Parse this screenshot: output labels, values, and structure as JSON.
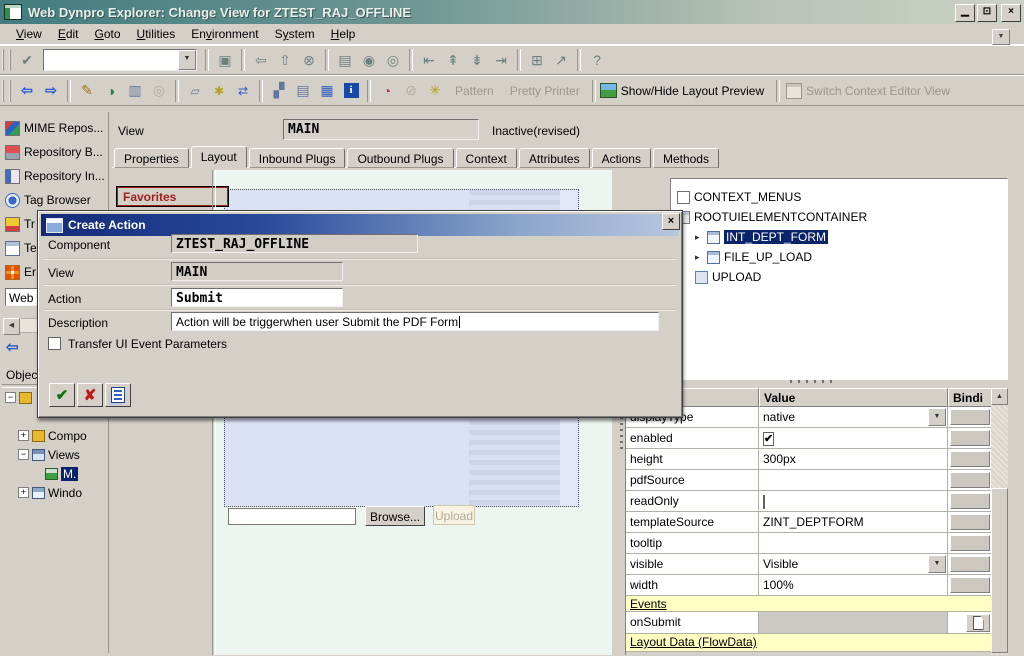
{
  "titlebar": {
    "title": "Web Dynpro Explorer: Change View for ZTEST_RAJ_OFFLINE"
  },
  "menubar": {
    "items": [
      {
        "label": "View",
        "u": 0
      },
      {
        "label": "Edit",
        "u": 0
      },
      {
        "label": "Goto",
        "u": 0
      },
      {
        "label": "Utilities",
        "u": 0
      },
      {
        "label": "Environment",
        "u": 2
      },
      {
        "label": "System",
        "u": 1
      },
      {
        "label": "Help",
        "u": 0
      }
    ]
  },
  "app_toolbar": {
    "pattern": "Pattern",
    "pretty_printer": "Pretty Printer",
    "show_hide_layout_preview": "Show/Hide Layout Preview",
    "switch_context_editor": "Switch Context Editor View"
  },
  "sidebar": {
    "buttons": [
      {
        "label": "MIME Repos...",
        "icon": "mime-repository-icon",
        "cls": "si-mime"
      },
      {
        "label": "Repository B...",
        "icon": "repository-browser-icon",
        "cls": "si-repob"
      },
      {
        "label": "Repository In...",
        "icon": "repository-infosystem-icon",
        "cls": "si-repoi"
      },
      {
        "label": "Tag Browser",
        "icon": "tag-browser-icon",
        "cls": "si-tag"
      },
      {
        "label": "Tr",
        "icon": "transport-icon",
        "cls": "si-truck"
      },
      {
        "label": "Te",
        "icon": "test-icon",
        "cls": "si-table"
      },
      {
        "label": "Er",
        "icon": "messages-icon",
        "cls": "si-grid"
      }
    ],
    "filter_value": "Web",
    "objects_label": "Objec",
    "tree": [
      {
        "label": "",
        "exp": "-",
        "icon": "ti-component",
        "level": 0
      },
      {
        "label": "",
        "spacer": true,
        "level": 1
      },
      {
        "label": "Compo",
        "exp": "+",
        "icon": "ti-component",
        "level": 1
      },
      {
        "label": "Views",
        "exp": "-",
        "icon": "ti-views",
        "level": 1
      },
      {
        "label": "M.",
        "icon": "ti-view",
        "level": 2,
        "selected": true
      },
      {
        "label": "Windo",
        "exp": "+",
        "icon": "ti-windows",
        "level": 1
      }
    ]
  },
  "view_header": {
    "label": "View",
    "value": "MAIN",
    "status": "Inactive(revised)"
  },
  "tabstrip": {
    "tabs": [
      "Properties",
      "Layout",
      "Inbound Plugs",
      "Outbound Plugs",
      "Context",
      "Attributes",
      "Actions",
      "Methods"
    ],
    "active": "Layout"
  },
  "layout_editor": {
    "favorites": "Favorites",
    "file_value": "",
    "browse": "Browse...",
    "upload": "Upload"
  },
  "dialog": {
    "title": "Create Action",
    "rows": [
      {
        "label": "Component",
        "value": "ZTEST_RAJ_OFFLINE",
        "readonly": true
      },
      {
        "label": "View",
        "value": "MAIN",
        "readonly": true
      },
      {
        "label": "Action",
        "value": "Submit",
        "readonly": false
      },
      {
        "label": "Description",
        "value": "Action will be triggerwhen user Submit the PDF Form",
        "readonly": false,
        "plain": true,
        "caret": true
      }
    ],
    "checkbox": {
      "label": "Transfer UI Event Parameters",
      "checked": false
    }
  },
  "ui_hierarchy": [
    {
      "label": "CONTEXT_MENUS",
      "icon": "ui-ctx",
      "icon_name": "context-menus-icon",
      "level": 0
    },
    {
      "label": "ROOTUIELEMENTCONTAINER",
      "icon": "ui-cont",
      "icon_name": "container-icon",
      "level": 0
    },
    {
      "label": "INT_DEPT_FORM",
      "icon": "ui-form",
      "icon_name": "interactive-form-icon",
      "level": 1,
      "arrow": true,
      "selected": true
    },
    {
      "label": "FILE_UP_LOAD",
      "icon": "ui-form",
      "icon_name": "interactive-form-icon",
      "level": 1,
      "arrow": true
    },
    {
      "label": "UPLOAD",
      "icon": "ui-upload",
      "icon_name": "upload-element-icon",
      "level": 1
    }
  ],
  "properties": {
    "value_col": "Value",
    "binding_col": "Bindi",
    "rows": [
      {
        "name": "displayType",
        "value": "native",
        "kind": "dropdown"
      },
      {
        "name": "enabled",
        "kind": "checkbox",
        "checked": true
      },
      {
        "name": "height",
        "value": "300px",
        "kind": "text"
      },
      {
        "name": "pdfSource",
        "value": "",
        "kind": "text"
      },
      {
        "name": "readOnly",
        "kind": "checkbox",
        "checked": false
      },
      {
        "name": "templateSource",
        "value": "ZINT_DEPTFORM",
        "kind": "text"
      },
      {
        "name": "tooltip",
        "value": "",
        "kind": "text"
      },
      {
        "name": "visible",
        "value": "Visible",
        "kind": "dropdown"
      },
      {
        "name": "width",
        "value": "100%",
        "kind": "text"
      },
      {
        "name": "Events",
        "kind": "section"
      },
      {
        "name": "onSubmit",
        "value": "",
        "kind": "event"
      },
      {
        "name": "Layout Data (FlowData)",
        "kind": "section",
        "cut": true
      }
    ]
  },
  "icons": {
    "minimize": "▁",
    "restore": "⊡",
    "close": "×",
    "menu-more": "▼",
    "enter": "✔",
    "combo-drop": "▼",
    "save": "▣",
    "back": "⇦",
    "exit": "⇧",
    "cancel": "⊗",
    "print": "▤",
    "find": "◉",
    "find-next": "◎",
    "first-page": "⇤",
    "prev-page": "⇞",
    "next-page": "⇟",
    "last-page": "⇥",
    "new-session": "⊞",
    "shortcut": "↗",
    "help": "?",
    "nav-back": "⇦",
    "nav-forward": "⇨",
    "edit": "✎",
    "toggle-display": "◑",
    "copy-view": "▥",
    "inactive-loop": "◎",
    "check-a": "▱",
    "check-b": "✱",
    "check-c": "⇄",
    "hierarchy": "▞",
    "layers": "▤",
    "table-view": "▦",
    "info": "i",
    "pie": "◔",
    "stop": "⊘",
    "wand": "✳",
    "dialog-ok": "✔",
    "dialog-cancel": "✘",
    "scroll-left": "◀",
    "blue-back": "⇦",
    "scroll-up": "▲",
    "dropdown": "▼",
    "checkmark": "✔",
    "child-arrow": "▸"
  }
}
